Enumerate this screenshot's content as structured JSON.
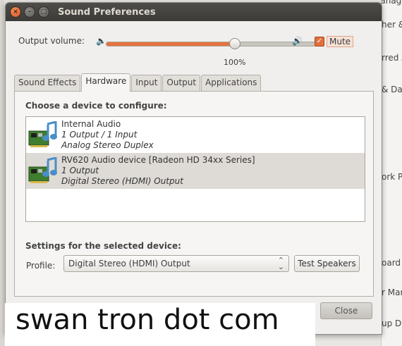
{
  "background": {
    "fragments": [
      "Manager",
      "her &",
      "rred A",
      "& Dat",
      "ork P",
      "oard",
      "r Man",
      "up Dis"
    ]
  },
  "window": {
    "title": "Sound Preferences"
  },
  "volume": {
    "label": "Output volume:",
    "percent_label": "100%",
    "level_fraction": 0.61,
    "mute_label": "Mute",
    "mute_checked": true
  },
  "tabs": [
    "Sound Effects",
    "Hardware",
    "Input",
    "Output",
    "Applications"
  ],
  "active_tab": "Hardware",
  "hardware": {
    "choose_heading": "Choose a device to configure:",
    "devices": [
      {
        "name": "Internal Audio",
        "line1": "1 Output / 1 Input",
        "line2": "Analog Stereo Duplex",
        "selected": false
      },
      {
        "name": "RV620 Audio device [Radeon HD 34xx Series]",
        "line1": "1 Output",
        "line2": "Digital Stereo (HDMI) Output",
        "selected": true
      }
    ],
    "settings_heading": "Settings for the selected device:",
    "profile_label": "Profile:",
    "profile_value": "Digital Stereo (HDMI) Output",
    "test_button": "Test Speakers"
  },
  "close_button": "Close",
  "watermark": "swan tron dot com",
  "colors": {
    "accent": "#e6723d",
    "titlebar": "#3c3b37"
  }
}
